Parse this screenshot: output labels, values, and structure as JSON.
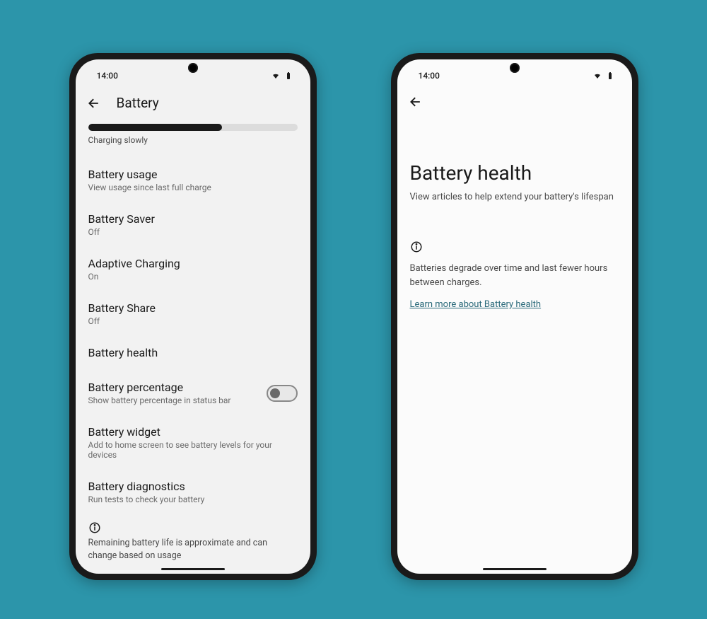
{
  "status": {
    "time": "14:00"
  },
  "left": {
    "title": "Battery",
    "charging": "Charging slowly",
    "progress_pct": 64,
    "items": {
      "usage": {
        "title": "Battery usage",
        "sub": "View usage since last full charge"
      },
      "saver": {
        "title": "Battery Saver",
        "sub": "Off"
      },
      "adaptive": {
        "title": "Adaptive Charging",
        "sub": "On"
      },
      "share": {
        "title": "Battery Share",
        "sub": "Off"
      },
      "health": {
        "title": "Battery health"
      },
      "percentage": {
        "title": "Battery percentage",
        "sub": "Show battery percentage in status bar"
      },
      "widget": {
        "title": "Battery widget",
        "sub": "Add to home screen to see battery levels for your devices"
      },
      "diagnostics": {
        "title": "Battery diagnostics",
        "sub": "Run tests to check your battery"
      }
    },
    "footnote": "Remaining battery life is approximate and can change based on usage"
  },
  "right": {
    "title": "Battery health",
    "subtitle": "View articles to help extend your battery's lifespan",
    "info": "Batteries degrade over time and last fewer hours between charges.",
    "link": "Learn more about Battery health"
  }
}
